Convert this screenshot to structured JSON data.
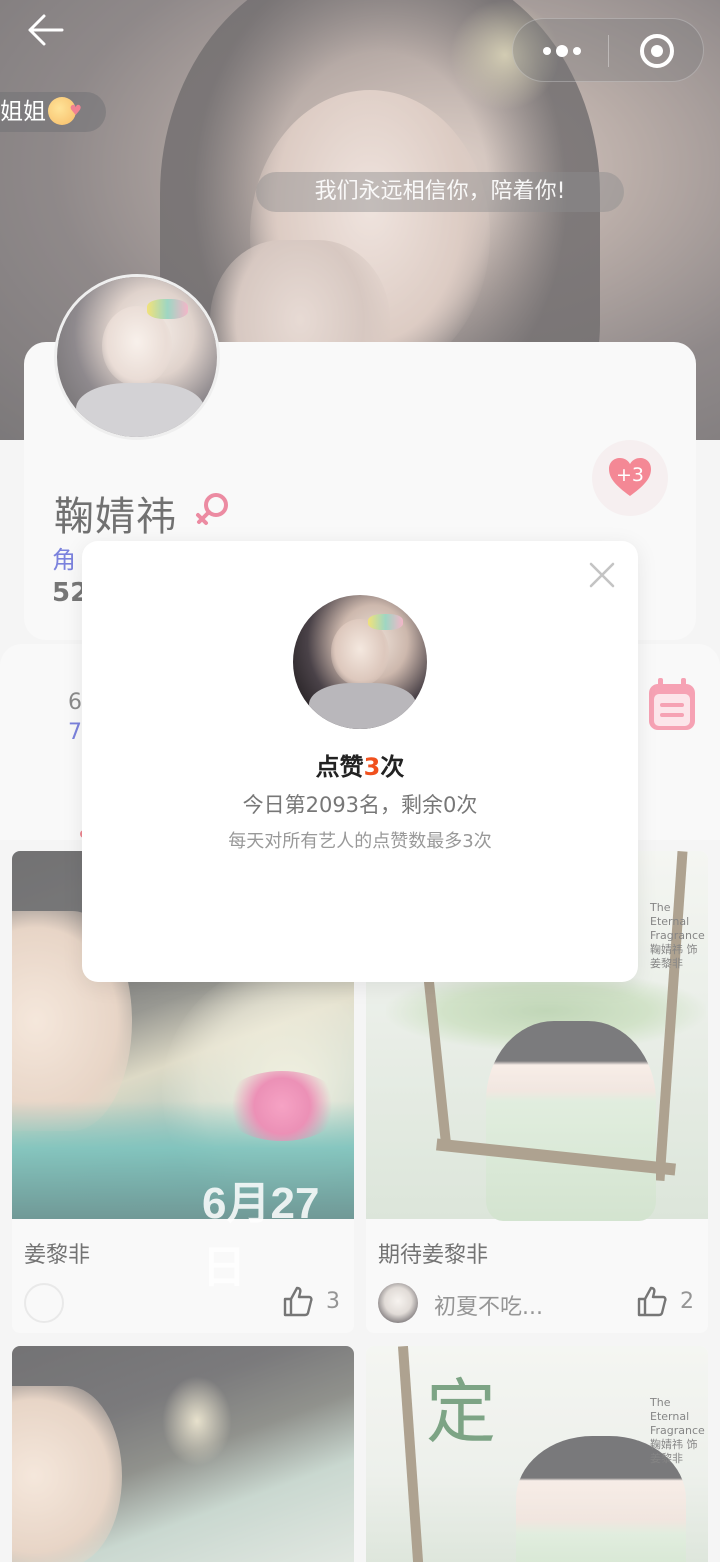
{
  "hero": {
    "danmaku_left": "姐姐",
    "danmaku_center": "我们永远相信你，陪着你!"
  },
  "profile": {
    "name": "鞠婧祎",
    "gender_icon": "female-symbol-icon",
    "heart_count": "+3",
    "role_prefix": "角",
    "number_prefix": "52"
  },
  "stats": {
    "line1": "6",
    "line2": "7"
  },
  "posts": [
    {
      "caption": "姜黎非",
      "user": "",
      "likes": "3",
      "image_text": "6月27日"
    },
    {
      "caption": "期待姜黎非",
      "user": "初夏不吃...",
      "likes": "2",
      "poster_text": "The Eternal Fragrance 鞠婧祎 饰 姜黎非"
    },
    {
      "caption": "",
      "user": "",
      "likes": ""
    },
    {
      "caption": "",
      "user": "",
      "likes": "",
      "poster_text": "The Eternal Fragrance 鞠婧祎 饰 姜黎非",
      "big_char": "定"
    }
  ],
  "modal": {
    "title_prefix": "点赞",
    "title_count": "3",
    "title_suffix": "次",
    "rank_text": "今日第2093名，剩余0次",
    "note_text": "每天对所有艺人的点赞数最多3次"
  },
  "colors": {
    "accent_orange": "#f0501d",
    "heart_red": "#e8344f",
    "role_blue": "#2b36c9"
  }
}
